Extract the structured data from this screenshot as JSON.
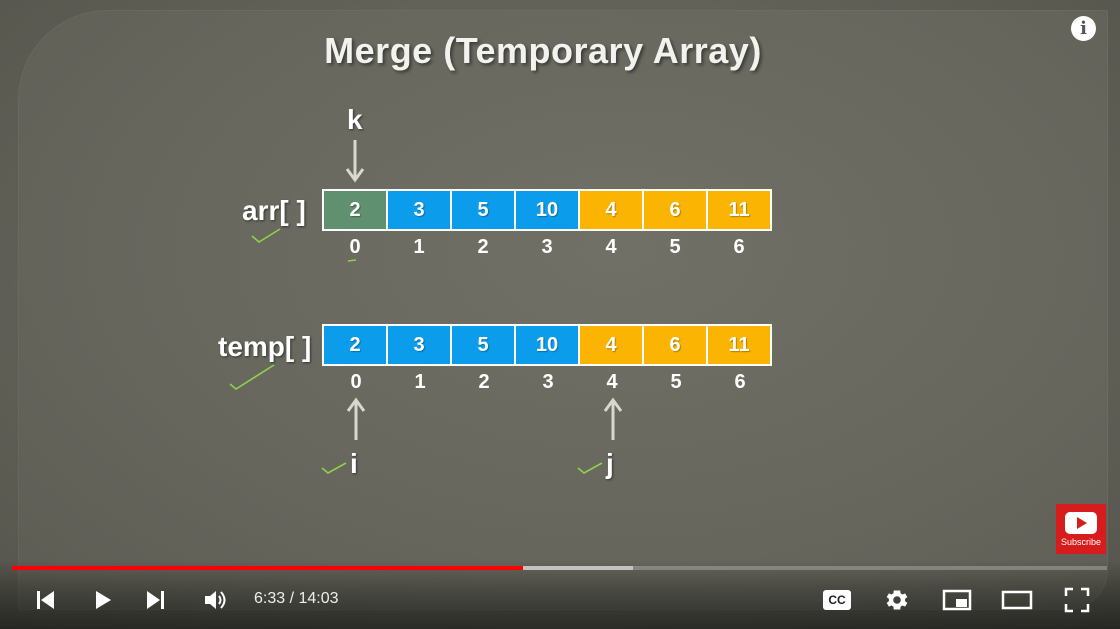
{
  "slide": {
    "title": "Merge (Temporary Array)",
    "arr": {
      "label": "arr[ ]",
      "cells": [
        {
          "value": "2",
          "color": "#5f9070"
        },
        {
          "value": "3",
          "color": "#0c9cec"
        },
        {
          "value": "5",
          "color": "#0c9cec"
        },
        {
          "value": "10",
          "color": "#0c9cec"
        },
        {
          "value": "4",
          "color": "#fbb401"
        },
        {
          "value": "6",
          "color": "#fbb401"
        },
        {
          "value": "11",
          "color": "#fbb401"
        }
      ],
      "indices": [
        "0",
        "1",
        "2",
        "3",
        "4",
        "5",
        "6"
      ]
    },
    "temp": {
      "label": "temp[ ]",
      "cells": [
        {
          "value": "2",
          "color": "#0c9cec"
        },
        {
          "value": "3",
          "color": "#0c9cec"
        },
        {
          "value": "5",
          "color": "#0c9cec"
        },
        {
          "value": "10",
          "color": "#0c9cec"
        },
        {
          "value": "4",
          "color": "#fbb401"
        },
        {
          "value": "6",
          "color": "#fbb401"
        },
        {
          "value": "11",
          "color": "#fbb401"
        }
      ],
      "indices": [
        "0",
        "1",
        "2",
        "3",
        "4",
        "5",
        "6"
      ]
    },
    "pointers": {
      "k": "k",
      "i": "i",
      "j": "j"
    },
    "annotation_color": "#8dd14a"
  },
  "player": {
    "time_current": "6:33",
    "time_separator": " / ",
    "time_total": "14:03",
    "progress_fraction": 0.467,
    "buffered_fraction": 0.567,
    "subscribe_label": "Subscribe",
    "icons": [
      "previous-icon",
      "play-icon",
      "next-icon",
      "volume-icon",
      "captions-icon",
      "settings-icon",
      "miniplayer-icon",
      "theater-mode-icon",
      "fullscreen-icon",
      "info-icon"
    ],
    "captions_label": "CC",
    "info_label": "i"
  }
}
